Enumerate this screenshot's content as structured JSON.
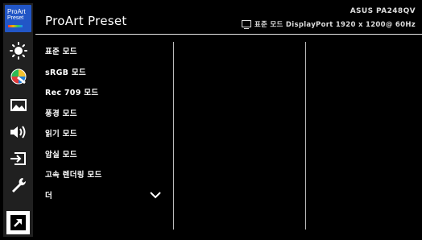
{
  "logo": {
    "line1": "ProArt",
    "line2": "Preset"
  },
  "header": {
    "title": "ProArt Preset",
    "model": "ASUS PA248QV",
    "status": "표준 모드 DisplayPort 1920 x 1200@ 60Hz"
  },
  "menu": {
    "items": [
      "표준 모드",
      "sRGB 모드",
      "Rec 709 모드",
      "풍경 모드",
      "읽기 모드",
      "암실 모드",
      "고속 렌더링 모드",
      "더"
    ]
  },
  "rail": {
    "icons": [
      "proart-logo",
      "brightness-icon",
      "color-icon",
      "image-icon",
      "sound-icon",
      "input-icon",
      "settings-wrench-icon",
      "shortcut-icon"
    ]
  },
  "colors": {
    "accent": "#2256c6",
    "background": "#000000",
    "rail": "#202020"
  }
}
